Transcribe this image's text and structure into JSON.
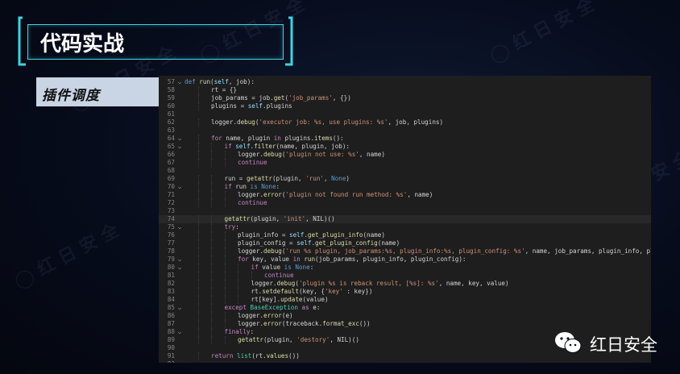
{
  "slide": {
    "title": "代码实战",
    "subtitle": "插件调度",
    "brand": "红日安全"
  },
  "code": {
    "lines": [
      {
        "no": "57",
        "fold": "v",
        "indent": 0,
        "html": "<span class=\"k\">def</span> <span class=\"f\">run</span>(<span class=\"v\">self</span>, job):"
      },
      {
        "no": "58",
        "fold": "",
        "indent": 2,
        "html": "rt = {}"
      },
      {
        "no": "59",
        "fold": "",
        "indent": 2,
        "html": "job_params = job.<span class=\"f\">get</span>(<span class=\"s\">'job_params'</span>, {})"
      },
      {
        "no": "60",
        "fold": "",
        "indent": 2,
        "html": "plugins = <span class=\"v\">self</span>.plugins"
      },
      {
        "no": "61",
        "fold": "",
        "indent": 0,
        "html": ""
      },
      {
        "no": "62",
        "fold": "",
        "indent": 2,
        "html": "logger.<span class=\"f\">debug</span>(<span class=\"s\">'executor job: %s, use plugins: %s'</span>, job, plugins)"
      },
      {
        "no": "63",
        "fold": "",
        "indent": 0,
        "html": ""
      },
      {
        "no": "64",
        "fold": "v",
        "indent": 2,
        "html": "<span class=\"kc\">for</span> name, plugin <span class=\"kc\">in</span> plugins.<span class=\"f\">items</span>():"
      },
      {
        "no": "65",
        "fold": "v",
        "indent": 3,
        "html": "<span class=\"kc\">if</span> <span class=\"v\">self</span>.<span class=\"f\">filter</span>(name, plugin, job):"
      },
      {
        "no": "66",
        "fold": "",
        "indent": 4,
        "html": "logger.<span class=\"f\">debug</span>(<span class=\"s\">'plugin not use: %s'</span>, name)"
      },
      {
        "no": "67",
        "fold": "",
        "indent": 4,
        "html": "<span class=\"kc\">continue</span>"
      },
      {
        "no": "68",
        "fold": "",
        "indent": 0,
        "html": ""
      },
      {
        "no": "69",
        "fold": "",
        "indent": 3,
        "html": "run = <span class=\"f\">getattr</span>(plugin, <span class=\"s\">'run'</span>, <span class=\"k\">None</span>)"
      },
      {
        "no": "70",
        "fold": "v",
        "indent": 3,
        "html": "<span class=\"kc\">if</span> run <span class=\"k\">is</span> <span class=\"k\">None</span>:"
      },
      {
        "no": "71",
        "fold": "",
        "indent": 4,
        "html": "logger.<span class=\"f\">error</span>(<span class=\"s\">'plugin not found run method: %s'</span>, name)"
      },
      {
        "no": "72",
        "fold": "",
        "indent": 4,
        "html": "<span class=\"kc\">continue</span>"
      },
      {
        "no": "73",
        "fold": "",
        "indent": 0,
        "html": ""
      },
      {
        "no": "74",
        "fold": "",
        "indent": 3,
        "html": "<span class=\"f\">getattr</span>(plugin, <span class=\"s\">'init'</span>, NIL)()"
      },
      {
        "no": "75",
        "fold": "v",
        "indent": 3,
        "html": "<span class=\"kc\">try</span>:"
      },
      {
        "no": "76",
        "fold": "",
        "indent": 4,
        "html": "plugin_info = <span class=\"v\">self</span>.<span class=\"f\">get_plugin_info</span>(name)"
      },
      {
        "no": "77",
        "fold": "",
        "indent": 4,
        "html": "plugin_config = <span class=\"v\">self</span>.<span class=\"f\">get_plugin_config</span>(name)"
      },
      {
        "no": "78",
        "fold": "",
        "indent": 4,
        "html": "logger.<span class=\"f\">debug</span>(<span class=\"s\">'run %s plugin, job_params:%s, plugin_info:%s, plugin_config: %s'</span>, name, job_params, plugin_info, plugin_config)"
      },
      {
        "no": "79",
        "fold": "v",
        "indent": 4,
        "html": "<span class=\"kc\">for</span> key, value <span class=\"kc\">in</span> <span class=\"f\">run</span>(job_params, plugin_info, plugin_config):"
      },
      {
        "no": "80",
        "fold": "v",
        "indent": 5,
        "html": "<span class=\"kc\">if</span> value <span class=\"k\">is</span> <span class=\"k\">None</span>:"
      },
      {
        "no": "81",
        "fold": "",
        "indent": 6,
        "html": "<span class=\"kc\">continue</span>"
      },
      {
        "no": "82",
        "fold": "",
        "indent": 5,
        "html": "logger.<span class=\"f\">debug</span>(<span class=\"s\">'plugin %s is reback result, [%s]: %s'</span>, name, key, value)"
      },
      {
        "no": "83",
        "fold": "",
        "indent": 5,
        "html": "rt.<span class=\"f\">setdefault</span>(key, {<span class=\"s\">'key'</span> : key})"
      },
      {
        "no": "84",
        "fold": "",
        "indent": 5,
        "html": "rt[key].<span class=\"f\">update</span>(value)"
      },
      {
        "no": "85",
        "fold": "v",
        "indent": 3,
        "html": "<span class=\"kc\">except</span> <span class=\"b\">BaseException</span> <span class=\"kc\">as</span> e:"
      },
      {
        "no": "86",
        "fold": "",
        "indent": 4,
        "html": "logger.<span class=\"f\">error</span>(e)"
      },
      {
        "no": "87",
        "fold": "",
        "indent": 4,
        "html": "logger.<span class=\"f\">error</span>(traceback.<span class=\"f\">format_exc</span>())"
      },
      {
        "no": "88",
        "fold": "v",
        "indent": 3,
        "html": "<span class=\"kc\">finally</span>:"
      },
      {
        "no": "89",
        "fold": "",
        "indent": 4,
        "html": "<span class=\"f\">getattr</span>(plugin, <span class=\"s\">'destory'</span>, NIL)()"
      },
      {
        "no": "90",
        "fold": "",
        "indent": 0,
        "html": ""
      },
      {
        "no": "91",
        "fold": "",
        "indent": 2,
        "html": "<span class=\"kc\">return</span> <span class=\"b\">list</span>(rt.<span class=\"f\">values</span>())"
      },
      {
        "no": "92",
        "fold": "",
        "indent": 0,
        "html": ""
      }
    ]
  },
  "icons": {
    "title_frame": "bracket-frame",
    "logo": "wechat-icon"
  },
  "colors": {
    "accent": "#3fd2e0",
    "code_bg": "#1e1e1e"
  }
}
